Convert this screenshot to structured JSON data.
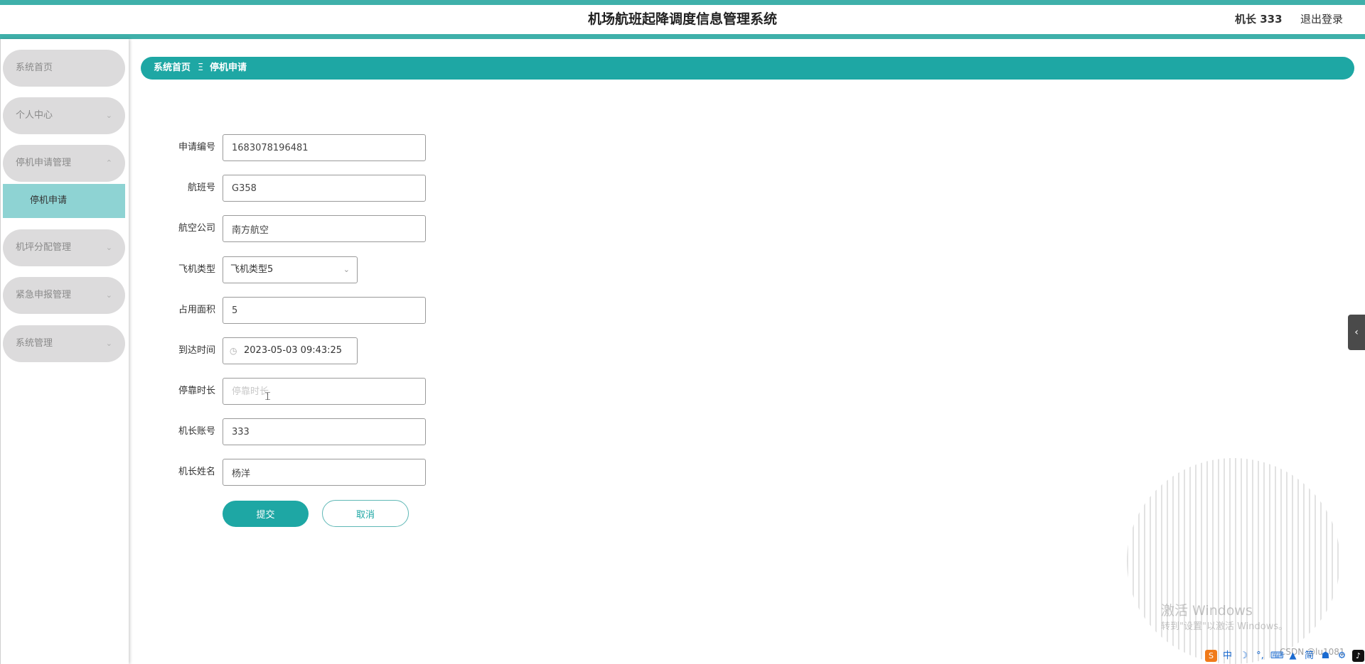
{
  "header": {
    "title": "机场航班起降调度信息管理系统",
    "user": "机长 333",
    "logout": "退出登录"
  },
  "sidebar": {
    "items": [
      {
        "label": "系统首页",
        "chevron": ""
      },
      {
        "label": "个人中心",
        "chevron": "⌄"
      },
      {
        "label": "停机申请管理",
        "chevron": "⌃"
      },
      {
        "label": "机坪分配管理",
        "chevron": "⌄"
      },
      {
        "label": "紧急申报管理",
        "chevron": "⌄"
      },
      {
        "label": "系统管理",
        "chevron": "⌄"
      }
    ],
    "active_sub": "停机申请"
  },
  "breadcrumb": {
    "home": "系统首页",
    "separator": "Ξ",
    "current": "停机申请"
  },
  "form": {
    "application_no": {
      "label": "申请编号",
      "value": "1683078196481"
    },
    "flight_no": {
      "label": "航班号",
      "value": "G358"
    },
    "airline": {
      "label": "航空公司",
      "value": "南方航空"
    },
    "aircraft_type": {
      "label": "飞机类型",
      "value": "飞机类型5"
    },
    "area": {
      "label": "占用面积",
      "value": "5"
    },
    "arrival_time": {
      "label": "到达时间",
      "value": "2023-05-03 09:43:25"
    },
    "parking_duration": {
      "label": "停靠时长",
      "value": "",
      "placeholder": "停靠时长"
    },
    "captain_account": {
      "label": "机长账号",
      "value": "333"
    },
    "captain_name": {
      "label": "机长姓名",
      "value": "杨洋"
    },
    "submit": "提交",
    "cancel": "取消"
  },
  "overlay": {
    "watermark_title": "激活 Windows",
    "watermark_sub": "转到\"设置\"以激活 Windows。",
    "credit": "CSDN @lu1081"
  },
  "tray": [
    "S",
    "中",
    "☽",
    "°,",
    "⌨",
    "▲",
    "简",
    "☗",
    "⚙",
    "♪"
  ],
  "colors": {
    "accent": "#1ea7a4",
    "stripe": "#3fb0aa",
    "submenu_active": "#8ed3d3",
    "menu_bg": "#dcdbdc"
  }
}
